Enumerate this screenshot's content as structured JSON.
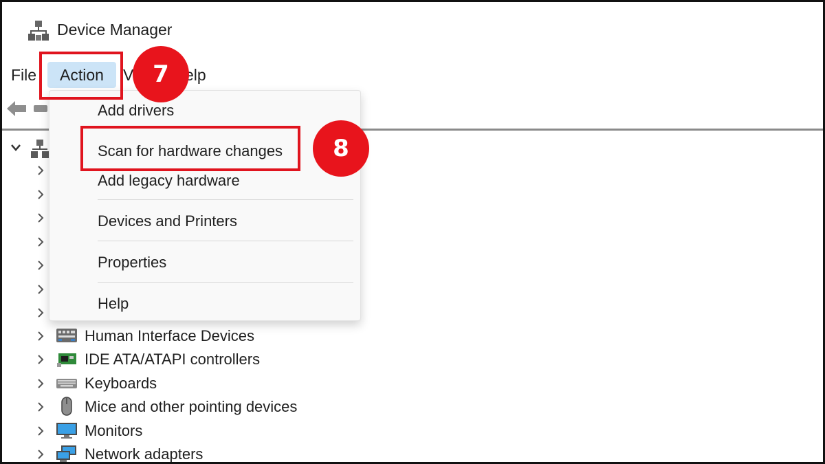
{
  "window": {
    "title": "Device Manager",
    "icon": "device-manager-icon"
  },
  "menu": {
    "file": "File",
    "action": "Action",
    "view_fragment": "V",
    "help_fragment": "elp"
  },
  "toolbar": {
    "back_icon": "back-arrow-icon",
    "forward_icon": "forward-arrow-icon"
  },
  "dropdown": {
    "items": [
      "Add drivers",
      "Scan for hardware changes",
      "Add legacy hardware",
      "Devices and Printers",
      "Properties",
      "Help"
    ]
  },
  "tree": {
    "rows": [
      {
        "label": "Human Interface Devices",
        "icon": "hid-icon"
      },
      {
        "label": "IDE ATA/ATAPI controllers",
        "icon": "ide-controller-icon"
      },
      {
        "label": "Keyboards",
        "icon": "keyboard-icon"
      },
      {
        "label": "Mice and other pointing devices",
        "icon": "mouse-icon"
      },
      {
        "label": "Monitors",
        "icon": "monitor-icon"
      },
      {
        "label": "Network adapters",
        "icon": "network-adapter-icon"
      }
    ]
  },
  "annotations": {
    "step_action": "7",
    "step_scan": "8",
    "accent": "#e0141e"
  }
}
